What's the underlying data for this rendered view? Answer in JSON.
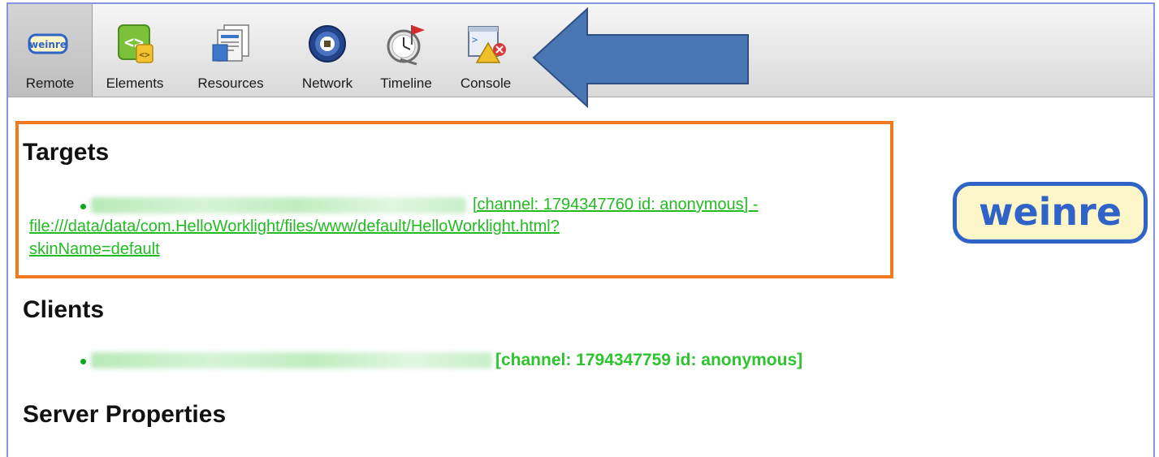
{
  "toolbar": {
    "tabs": [
      {
        "label": "Remote",
        "icon": "weinre-badge-icon",
        "selected": true
      },
      {
        "label": "Elements",
        "icon": "elements-code-icon"
      },
      {
        "label": "Resources",
        "icon": "resources-documents-icon"
      },
      {
        "label": "Network",
        "icon": "network-globe-icon"
      },
      {
        "label": "Timeline",
        "icon": "timeline-stopwatch-icon"
      },
      {
        "label": "Console",
        "icon": "console-warning-icon"
      }
    ],
    "badge_text": "weinre"
  },
  "annotation": {
    "arrow_color": "#4a77b4",
    "highlight_color": "#f07921"
  },
  "targets": {
    "title": "Targets",
    "items": [
      {
        "channel_info": "[channel: 1794347760 id: anonymous] -",
        "url_line1": "file:///data/data/com.HelloWorklight/files/www/default/HelloWorklight.html?",
        "url_line2": "skinName=default"
      }
    ]
  },
  "clients": {
    "title": "Clients",
    "items": [
      {
        "channel_info": "[channel: 1794347759 id: anonymous]"
      }
    ]
  },
  "server_properties": {
    "title": "Server Properties"
  },
  "logo": {
    "text": "weinre"
  },
  "colors": {
    "link_green": "#22bb22",
    "logo_blue": "#2f63c8",
    "logo_bg": "#fdf6c8"
  }
}
